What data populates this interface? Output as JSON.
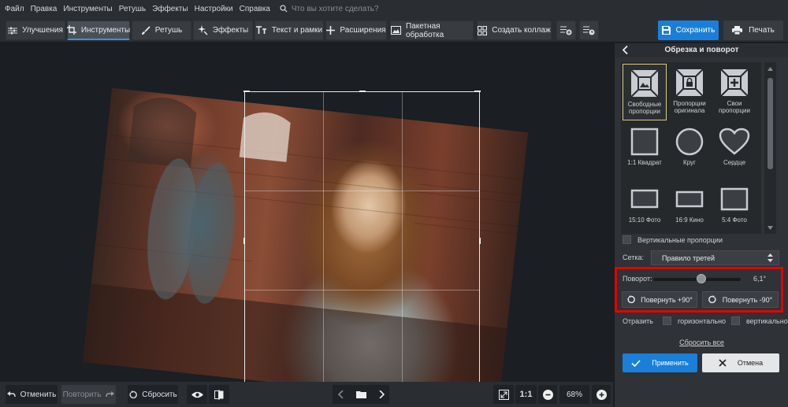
{
  "menu": [
    "Файл",
    "Правка",
    "Инструменты",
    "Ретушь",
    "Эффекты",
    "Настройки",
    "Справка"
  ],
  "search_placeholder": "Что вы хотите сделать?",
  "tabs": [
    {
      "label": "Улучшения",
      "icon": "sliders-icon"
    },
    {
      "label": "Инструменты",
      "icon": "crop-icon",
      "active": true
    },
    {
      "label": "Ретушь",
      "icon": "brush-icon"
    },
    {
      "label": "Эффекты",
      "icon": "sparkle-icon"
    },
    {
      "label": "Текст и рамки",
      "icon": "text-icon"
    },
    {
      "label": "Расширения",
      "icon": "plus-icon"
    },
    {
      "label": "Пакетная обработка",
      "icon": "gallery-icon"
    },
    {
      "label": "Создать коллаж",
      "icon": "grid-icon"
    }
  ],
  "save_label": "Сохранить",
  "print_label": "Печать",
  "bottom": {
    "undo": "Отменить",
    "redo": "Повторить",
    "reset": "Сбросить",
    "ratio": "1:1",
    "zoom": "68%"
  },
  "panel": {
    "title": "Обрезка и поворот",
    "presets": [
      {
        "label": "Свободные пропорции",
        "icon": "free-crop-icon",
        "selected": true
      },
      {
        "label": "Пропорции оригинала",
        "icon": "lock-crop-icon"
      },
      {
        "label": "Свои пропорции",
        "icon": "custom-crop-icon"
      },
      {
        "label": "1:1 Квадрат",
        "icon": "square-icon"
      },
      {
        "label": "Круг",
        "icon": "circle-icon"
      },
      {
        "label": "Сердце",
        "icon": "heart-icon"
      },
      {
        "label": "15:10 Фото",
        "icon": "rect-15-10-icon"
      },
      {
        "label": "16:9 Кино",
        "icon": "rect-16-9-icon"
      },
      {
        "label": "5:4 Фото",
        "icon": "rect-5-4-icon"
      }
    ],
    "vertical_label": "Вертикальные пропорции",
    "grid_label": "Сетка:",
    "grid_value": "Правило третей",
    "rotation_label": "Поворот:",
    "rotation_value": "6,1°",
    "rotation_fraction": 0.55,
    "rotate_plus": "Повернуть +90°",
    "rotate_minus": "Повернуть -90°",
    "flip_label": "Отразить",
    "flip_h": "горизонтально",
    "flip_v": "вертикально",
    "reset_all": "Сбросить все",
    "apply": "Применить",
    "cancel": "Отмена"
  },
  "colors": {
    "accent": "#1a7fd9",
    "highlight": "#e60000",
    "selected_border": "#d7ca8a"
  }
}
